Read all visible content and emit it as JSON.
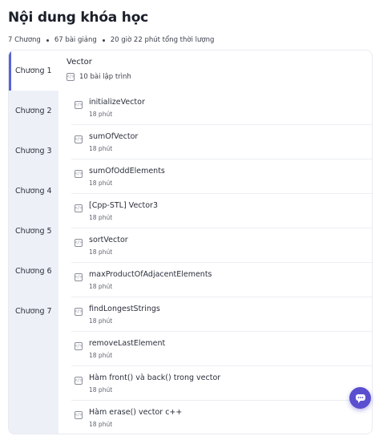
{
  "page": {
    "title": "Nội dung khóa học",
    "meta": {
      "chapters": "7 Chương",
      "lessons": "67 bài giảng",
      "duration": "20 giờ 22 phút tổng thời lượng"
    }
  },
  "sidebar": {
    "items": [
      {
        "label": "Chương 1",
        "active": true
      },
      {
        "label": "Chương 2",
        "active": false
      },
      {
        "label": "Chương 3",
        "active": false
      },
      {
        "label": "Chương 4",
        "active": false
      },
      {
        "label": "Chương 5",
        "active": false
      },
      {
        "label": "Chương 6",
        "active": false
      },
      {
        "label": "Chương 7",
        "active": false
      }
    ]
  },
  "chapter": {
    "title": "Vector",
    "subtitle": "10 bài lập trình",
    "icon": "code-icon"
  },
  "lessons": [
    {
      "name": "initializeVector",
      "duration": "18 phút",
      "icon": "code-icon"
    },
    {
      "name": "sumOfVector",
      "duration": "18 phút",
      "icon": "code-icon"
    },
    {
      "name": "sumOfOddElements",
      "duration": "18 phút",
      "icon": "code-icon"
    },
    {
      "name": "[Cpp-STL] Vector3",
      "duration": "18 phút",
      "icon": "code-icon"
    },
    {
      "name": "sortVector",
      "duration": "18 phút",
      "icon": "code-icon"
    },
    {
      "name": "maxProductOfAdjacentElements",
      "duration": "18 phút",
      "icon": "code-icon"
    },
    {
      "name": "findLongestStrings",
      "duration": "18 phút",
      "icon": "code-icon"
    },
    {
      "name": "removeLastElement",
      "duration": "18 phút",
      "icon": "code-icon"
    },
    {
      "name": "Hàm front() và back() trong vector",
      "duration": "18 phút",
      "icon": "code-icon"
    },
    {
      "name": "Hàm erase() vector c++",
      "duration": "18 phút",
      "icon": "code-icon"
    }
  ],
  "colors": {
    "accent": "#5a64d6",
    "sidebar_bg": "#eef0f8",
    "chat_button": "#5b4fd0"
  },
  "chat_button": {
    "icon": "chat-bubble-icon"
  }
}
